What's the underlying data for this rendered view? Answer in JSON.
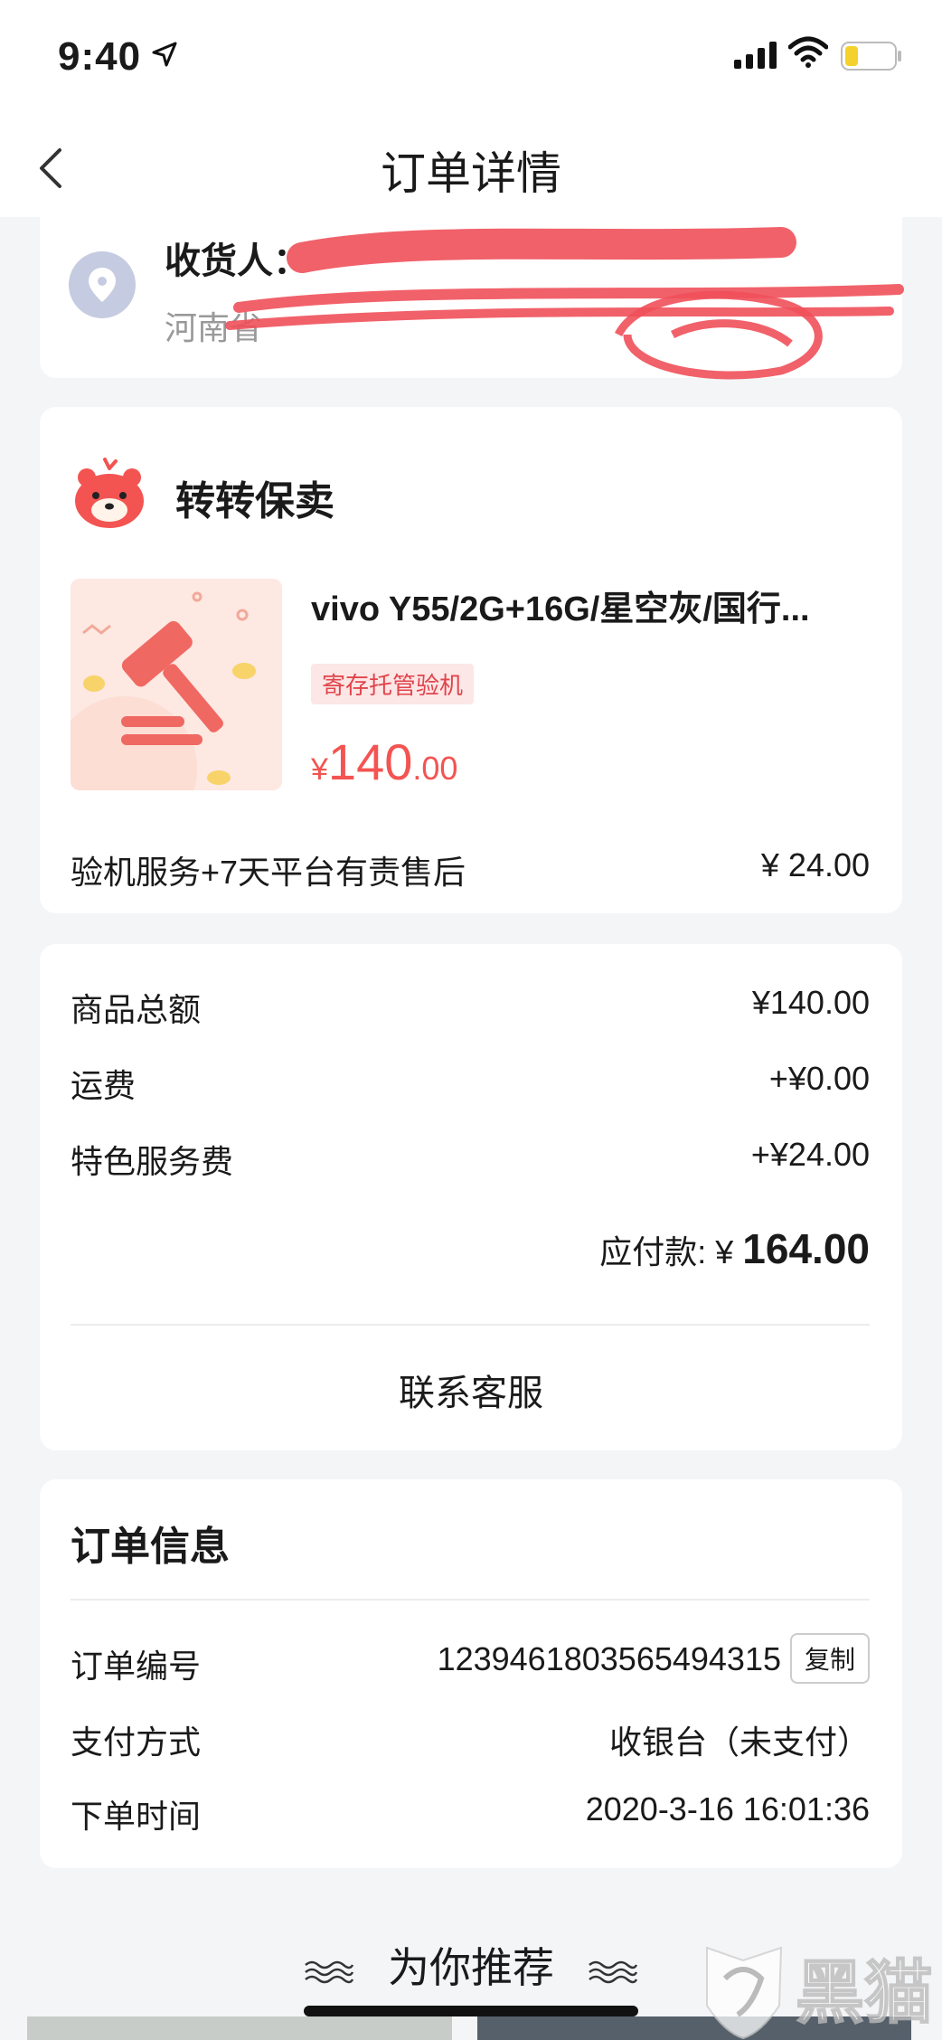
{
  "status_bar": {
    "time": "9:40"
  },
  "navbar": {
    "title": "订单详情"
  },
  "address": {
    "recipient_label": "收货人：",
    "detail": "河南省"
  },
  "seller": {
    "name": "转转保卖",
    "product_title": "vivo Y55/2G+16G/星空灰/国行...",
    "tag": "寄存托管验机",
    "price_symbol": "¥",
    "price_int": "140",
    "price_dec": ".00",
    "service_label": "验机服务+7天平台有责售后",
    "service_value": "¥ 24.00"
  },
  "summary": {
    "rows": [
      {
        "label": "商品总额",
        "value": "¥140.00"
      },
      {
        "label": "运费",
        "value": "+¥0.00"
      },
      {
        "label": "特色服务费",
        "value": "+¥24.00"
      }
    ],
    "due_label": "应付款: ¥ ",
    "due_value": "164.00",
    "contact": "联系客服"
  },
  "order_info": {
    "heading": "订单信息",
    "rows": [
      {
        "label": "订单编号",
        "value": "1239461803565494315"
      },
      {
        "label": "支付方式",
        "value": "收银台（未支付）"
      },
      {
        "label": "下单时间",
        "value": "2020-3-16 16:01:36"
      }
    ],
    "copy_label": "复制"
  },
  "recommend": {
    "title": "为你推荐"
  },
  "watermark": {
    "text": "黑猫"
  },
  "colors": {
    "accent": "#f35452",
    "tag_bg": "#fde6e6",
    "page_bg": "#f4f5f7"
  }
}
